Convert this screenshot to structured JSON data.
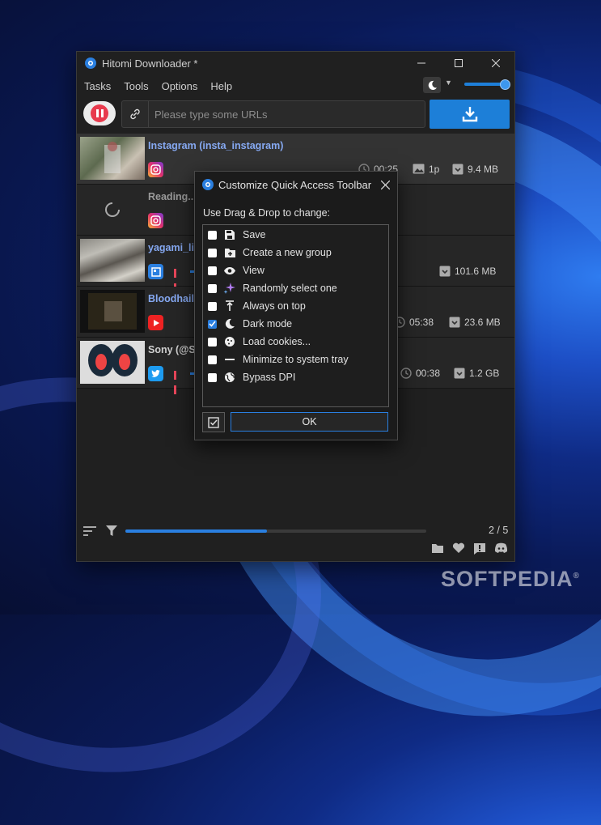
{
  "window": {
    "title": "Hitomi Downloader *"
  },
  "menu": [
    "Tasks",
    "Tools",
    "Options",
    "Help"
  ],
  "url_input": {
    "placeholder": "Please type some URLs"
  },
  "tasks": [
    {
      "title": "Instagram (insta_instagram)",
      "site": "instagram",
      "time": "00:25",
      "count": "1p",
      "size": "9.4 MB"
    },
    {
      "title": "Reading...",
      "site": "instagram"
    },
    {
      "title": "yagami_li",
      "site": "generic",
      "size": "101.6 MB"
    },
    {
      "title": "Bloodhail",
      "site": "youtube",
      "time": "05:38",
      "size": "23.6 MB"
    },
    {
      "title": "Sony (@Sc",
      "site": "twitter",
      "time": "00:38",
      "size": "1.2 GB"
    }
  ],
  "footer": {
    "page": "2 / 5",
    "progress": 0.47
  },
  "dialog": {
    "title": "Customize Quick Access Toolbar",
    "instruction": "Use Drag & Drop to change:",
    "items": [
      {
        "label": "Save",
        "checked": false,
        "icon": "save-icon"
      },
      {
        "label": "Create a new group",
        "checked": false,
        "icon": "new-group-icon"
      },
      {
        "label": "View",
        "checked": false,
        "icon": "eye-icon"
      },
      {
        "label": "Randomly select one",
        "checked": false,
        "icon": "sparkle-icon"
      },
      {
        "label": "Always on top",
        "checked": false,
        "icon": "pin-top-icon"
      },
      {
        "label": "Dark mode",
        "checked": true,
        "icon": "moon-icon"
      },
      {
        "label": "Load cookies...",
        "checked": false,
        "icon": "cookie-icon"
      },
      {
        "label": "Minimize to system tray",
        "checked": false,
        "icon": "minimize-icon"
      },
      {
        "label": "Bypass DPI",
        "checked": false,
        "icon": "globe-icon"
      }
    ],
    "ok_label": "OK"
  },
  "watermark": "SOFTPEDIA",
  "colors": {
    "accent": "#1d7fd8",
    "danger": "#e83a4d",
    "title_link": "#86a9f2"
  }
}
